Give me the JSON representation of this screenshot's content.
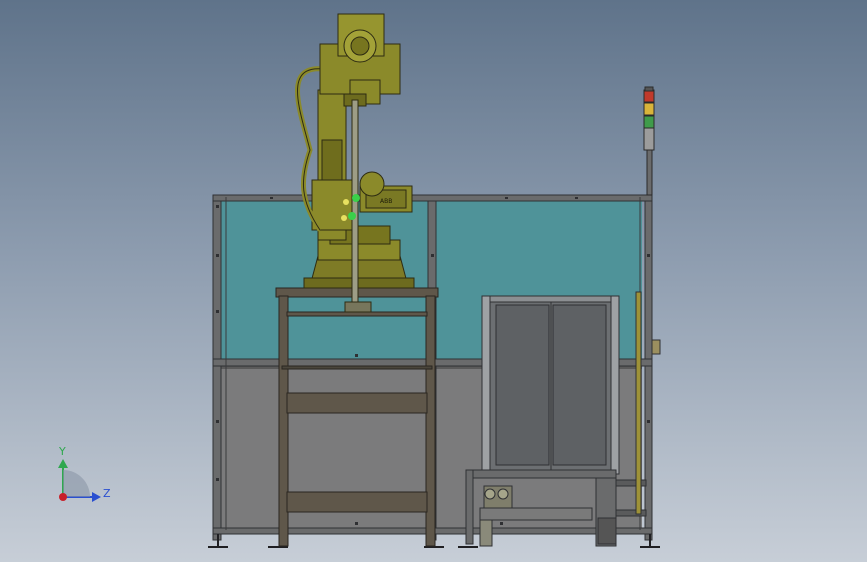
{
  "viewport": {
    "background_top": "#5f738a",
    "background_bottom": "#c7ced7"
  },
  "triad": {
    "y_label": "Y",
    "z_label": "Z",
    "y_color": "#2fa84f",
    "z_color": "#2a4fd0",
    "origin_color": "#c8202a"
  },
  "robot": {
    "base_label": "ABB",
    "body_color": "#8b8a2a"
  },
  "enclosure": {
    "glass_color": "#4f9399",
    "lower_panel_color": "#7a7a7a"
  },
  "stack_light": {
    "lamps": [
      "#c0392b",
      "#d9b43a",
      "#3f9b4a"
    ]
  }
}
